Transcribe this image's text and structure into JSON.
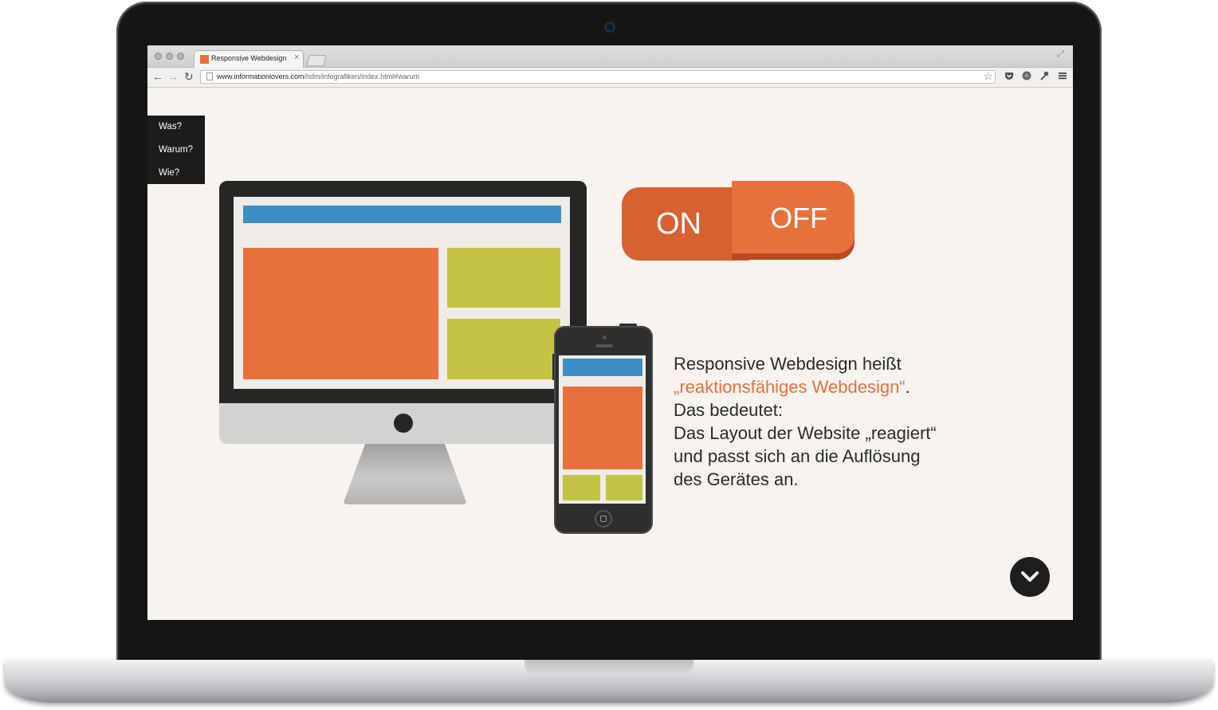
{
  "browser": {
    "tab_title": "Responsive Webdesign",
    "tab_close": "×",
    "url_domain": "www.informationlovers.com",
    "url_path": "/hdm/infografiken/index.html#warum"
  },
  "side_nav": {
    "items": [
      {
        "label": "Was?"
      },
      {
        "label": "Warum?"
      },
      {
        "label": "Wie?"
      }
    ]
  },
  "toggle": {
    "on_label": "ON",
    "off_label": "OFF"
  },
  "description": {
    "line1": "Responsive Webdesign heißt",
    "highlight": "„reaktionsfähiges Webdesign“",
    "highlight_suffix": ".",
    "line3": "Das bedeutet:",
    "line4": "Das Layout der Website „reagiert“",
    "line5": "und passt sich an die Auflösung",
    "line6": "des Gerätes an."
  },
  "colors": {
    "accent_orange": "#e8703c",
    "toggle_dark": "#d76131",
    "header_blue": "#3d8ec5",
    "lime": "#c3c443",
    "dark": "#1c1c1c",
    "page_bg": "#f7f4f0"
  },
  "icons": {
    "scroll_down": "chevron-down-icon",
    "back": "arrow-left-icon",
    "forward": "arrow-right-icon",
    "reload": "reload-icon",
    "bookmark": "star-icon",
    "menu": "hamburger-menu-icon"
  }
}
